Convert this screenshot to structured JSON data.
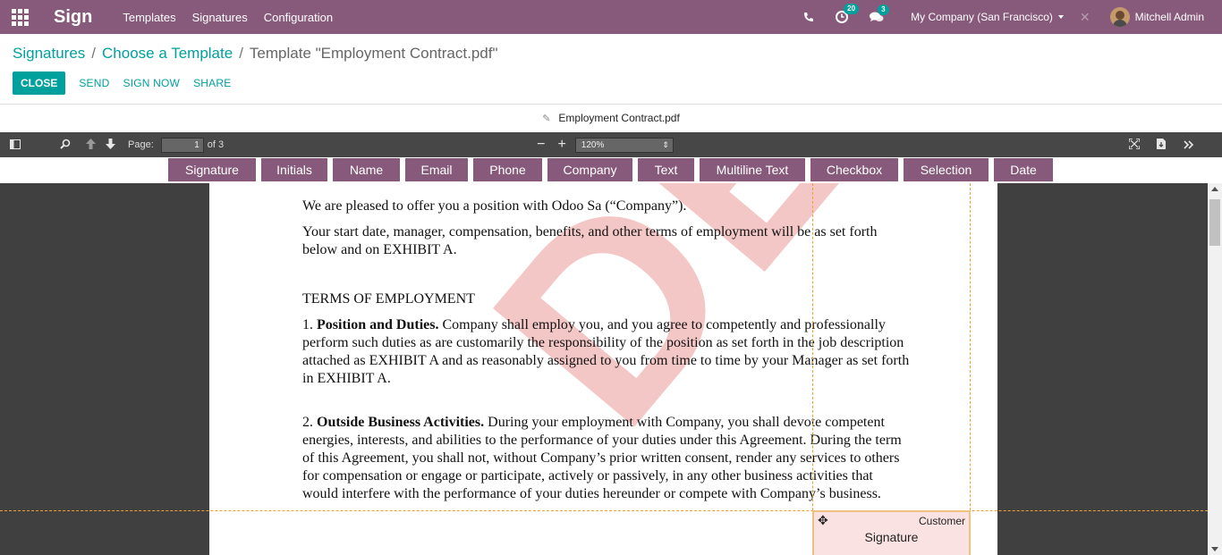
{
  "navbar": {
    "app_name": "Sign",
    "menu": [
      "Templates",
      "Signatures",
      "Configuration"
    ],
    "activity_count": "20",
    "messages_count": "3",
    "company": "My Company (San Francisco)",
    "user": "Mitchell Admin",
    "bg_color": "#875a7b"
  },
  "breadcrumb": {
    "items": [
      "Signatures",
      "Choose a Template"
    ],
    "current": "Template \"Employment Contract.pdf\""
  },
  "actions": {
    "close": "CLOSE",
    "send": "SEND",
    "sign_now": "SIGN NOW",
    "share": "SHARE"
  },
  "document": {
    "filename": "Employment Contract.pdf"
  },
  "pdf_toolbar": {
    "page_label": "Page:",
    "page_value": "1",
    "page_total": "of 3",
    "zoom": "120%"
  },
  "fields": [
    "Signature",
    "Initials",
    "Name",
    "Email",
    "Phone",
    "Company",
    "Text",
    "Multiline Text",
    "Checkbox",
    "Selection",
    "Date"
  ],
  "content": {
    "p1": "We are pleased to offer you a position with Odoo Sa (“Company”).",
    "p2": "Your start date, manager, compensation, benefits, and other terms of employment will be as set forth below and on EXHIBIT A.",
    "heading": "TERMS OF EMPLOYMENT",
    "s1_num": "1.  ",
    "s1_title": "Position and Duties.",
    "s1_text": " Company shall employ you, and you agree to competently and professionally perform such duties as are customarily the responsibility of the position as set forth in the job description attached as EXHIBIT A and as reasonably assigned to you from time to time by your Manager as set forth in EXHIBIT A.",
    "s2_num": "2. ",
    "s2_title": "Outside Business Activities.",
    "s2_text": " During your employment with Company, you shall devote competent energies, interests, and abilities to the performance of your duties under this Agreement. During the term of this Agreement, you shall not, without Company’s prior written consent, render any services to others for compensation or engage or participate, actively or passively, in any other business activities that would interfere with the performance of your duties hereunder or compete with Company’s business.",
    "watermark": "DEMO"
  },
  "signature_field": {
    "role": "Customer",
    "label": "Signature"
  }
}
